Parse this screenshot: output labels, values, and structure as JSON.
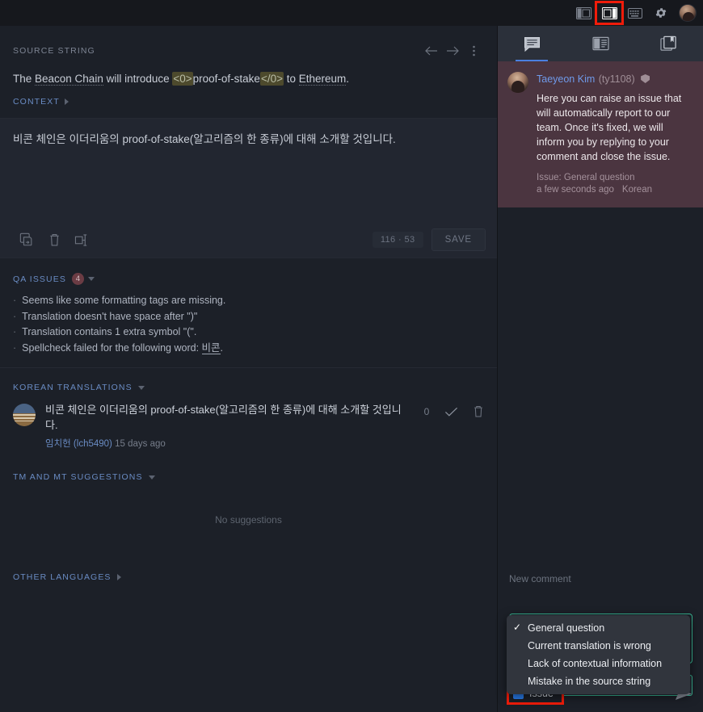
{
  "topbar": {
    "icons": [
      {
        "name": "layout-left-panel-icon",
        "label": "Layout left"
      },
      {
        "name": "layout-right-panel-icon",
        "label": "Layout right",
        "highlighted": true
      },
      {
        "name": "keyboard-shortcuts-icon",
        "label": "Keyboard shortcuts"
      },
      {
        "name": "settings-gear-icon",
        "label": "Settings"
      }
    ],
    "avatar_name": "user-avatar"
  },
  "editor": {
    "source_section_label": "SOURCE STRING",
    "source_text": {
      "pre": "The ",
      "dotted1": "Beacon Chain",
      "mid1": " will introduce ",
      "tag_open": "<0>",
      "inner": "proof-of-stake",
      "tag_close": "</0>",
      "mid2": " to ",
      "dotted2": "Ethereum",
      "post": "."
    },
    "context_label": "CONTEXT",
    "translation_text": "비콘 체인은 이더리움의 proof-of-stake(알고리즘의 한 종류)에 대해 소개할 것입니다.",
    "char_counter": "116 · 53",
    "save_label": "SAVE",
    "toolbar_icons": [
      {
        "name": "copy-source-icon"
      },
      {
        "name": "clear-translation-icon"
      },
      {
        "name": "insert-tag-icon"
      }
    ],
    "nav_icons": [
      {
        "name": "previous-string-arrow-icon"
      },
      {
        "name": "next-string-arrow-icon"
      },
      {
        "name": "more-options-icon"
      }
    ]
  },
  "qa": {
    "label": "QA ISSUES",
    "count": "4",
    "items": [
      {
        "text": "Seems like some formatting tags are missing."
      },
      {
        "text": "Translation doesn't have space after \")\""
      },
      {
        "text": "Translation contains 1 extra symbol \"(\"."
      },
      {
        "prefix": "Spellcheck failed for the following word: ",
        "word": "비콘",
        "suffix": "."
      }
    ]
  },
  "korean_translations": {
    "label": "KOREAN TRANSLATIONS",
    "entry": {
      "text": "비콘 체인은 이더리움의 proof-of-stake(알고리즘의 한 종류)에 대해 소개할 것입니다.",
      "user": "임치헌 (lch5490)",
      "time": "15 days ago",
      "vote_count": "0"
    }
  },
  "tm_suggestions": {
    "label": "TM AND MT SUGGESTIONS",
    "empty_text": "No suggestions"
  },
  "other_languages": {
    "label": "OTHER LANGUAGES"
  },
  "right_panel": {
    "tabs": [
      {
        "name": "tab-comments",
        "icon": "comment-bubble-icon",
        "active": true
      },
      {
        "name": "tab-terms",
        "icon": "glossary-terms-icon",
        "active": false
      },
      {
        "name": "tab-screenshots",
        "icon": "screenshots-book-icon",
        "active": false
      }
    ],
    "comment": {
      "author": "Taeyeon Kim",
      "handle": "(ty1108)",
      "body": "Here you can raise an issue that will automatically report to our team. Once it's fixed, we will inform you by replying to your comment and close the issue.",
      "issue_line": "Issue: General question",
      "time": "a few seconds ago",
      "language": "Korean"
    },
    "composer": {
      "new_comment_label": "New comment",
      "selected_option": "General question",
      "options": [
        {
          "label": "General question",
          "checked": true
        },
        {
          "label": "Current translation is wrong",
          "checked": false
        },
        {
          "label": "Lack of contextual information",
          "checked": false
        },
        {
          "label": "Mistake in the source string",
          "checked": false
        }
      ],
      "issue_checkbox_label": "Issue",
      "issue_checked": true,
      "send_icon": "send-arrow-icon"
    }
  },
  "colors": {
    "app_bg": "#1c2028",
    "topbar_bg": "#16181d",
    "panel_tabs_bg": "#2b303a",
    "comment_bg": "#4b3540",
    "accent_blue": "#4a7fe0",
    "accent_green": "#3ab795",
    "highlight_red": "#f01c0a",
    "tag_bg": "#4d4a2d",
    "qa_badge_bg": "#6b3c44"
  }
}
